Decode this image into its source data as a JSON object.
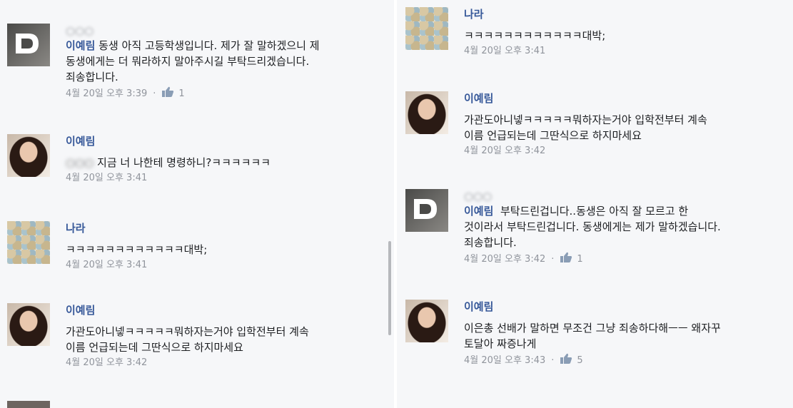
{
  "left": {
    "comments": [
      {
        "name": "이예림",
        "text_pre": "",
        "text_rest": " 동생 아직 고등학생입니다. 제가 잘 말하겠으니 제\n동생에게는 더 뭐라하지 말아주시길 부탁드리겠습니다.\n죄송합니다.",
        "meta": "4월 20일 오후 3:39",
        "likes": "1"
      },
      {
        "name": "이예림",
        "text": " 지금 너 나한테 명령하니?ㅋㅋㅋㅋㅋㅋ",
        "meta": "4월 20일 오후 3:41"
      },
      {
        "name": "나라",
        "text": "ㅋㅋㅋㅋㅋㅋㅋㅋㅋㅋㅋㅋ대박;",
        "meta": "4월 20일 오후 3:41"
      },
      {
        "name": "이예림",
        "text": "가관도아니넿ㅋㅋㅋㅋㅋ뭐하자는거야 입학전부터 계속\n이름 언급되는데 그딴식으로 하지마세요",
        "meta": "4월 20일 오후 3:42"
      }
    ]
  },
  "right": {
    "comments": [
      {
        "name": "나라",
        "text": "ㅋㅋㅋㅋㅋㅋㅋㅋㅋㅋㅋㅋ대박;",
        "meta": "4월 20일 오후 3:41"
      },
      {
        "name": "이예림",
        "text": "가관도아니넿ㅋㅋㅋㅋㅋ뭐하자는거야 입학전부터 계속\n이름 언급되는데 그딴식으로 하지마세요",
        "meta": "4월 20일 오후 3:42"
      },
      {
        "tag": "이예림",
        "text_rest": "  부탁드린겁니다..동생은 아직 잘 모르고 한\n것이라서 부탁드린겁니다. 동생에게는 제가 말하겠습니다.\n죄송합니다.",
        "meta": "4월 20일 오후 3:42",
        "likes": "1"
      },
      {
        "name": "이예림",
        "text": "이은총 선배가 말하면 무조건 그냥 죄송하다해ㅡㅡ 왜자꾸\n토달아 짜증나게",
        "meta": "4월 20일 오후 3:43",
        "likes": "5"
      }
    ]
  }
}
